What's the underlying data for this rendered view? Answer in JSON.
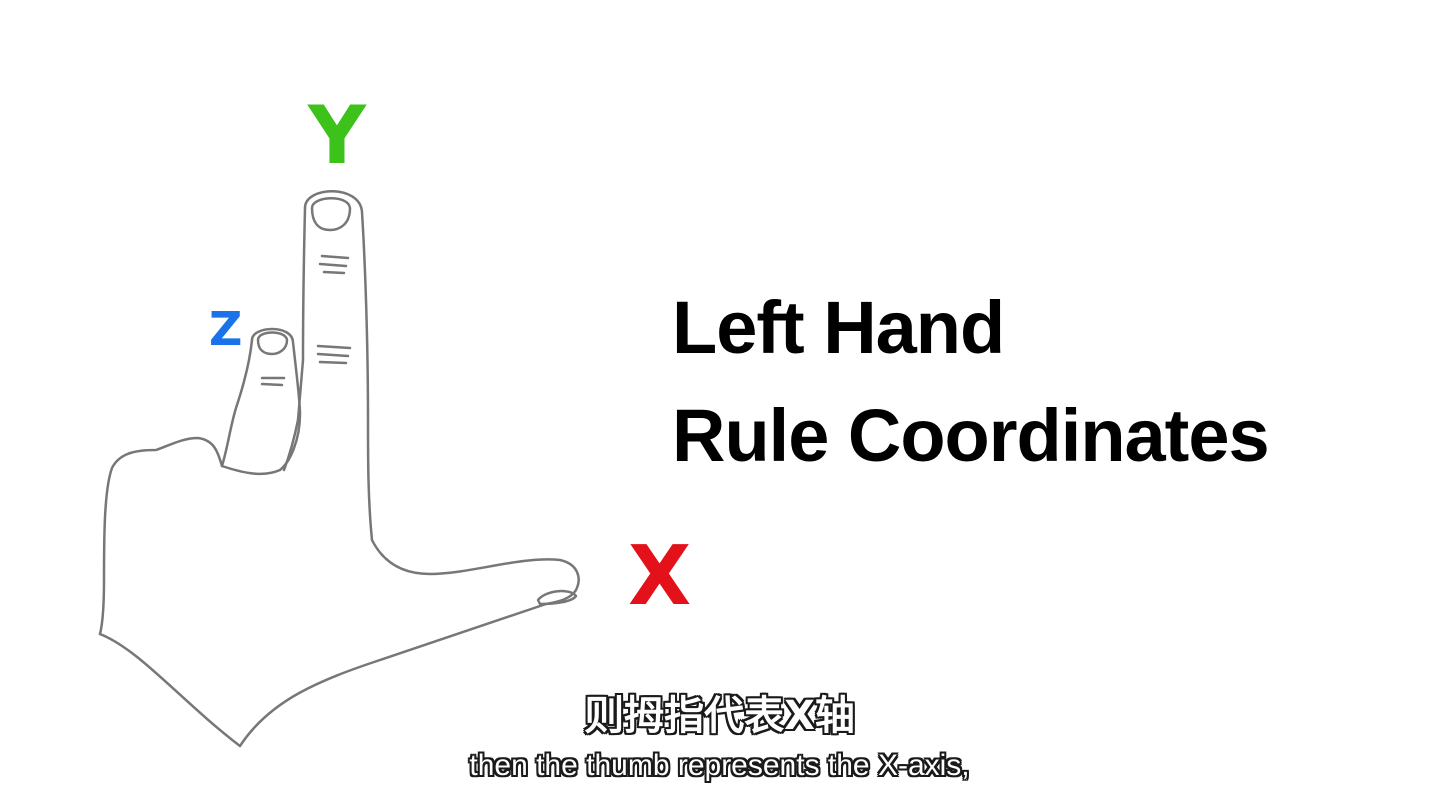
{
  "diagram": {
    "axes": {
      "y": {
        "label": "Y",
        "color": "#3cc21a"
      },
      "z": {
        "label": "Z",
        "color": "#1a73e8"
      },
      "x": {
        "label": "X",
        "color": "#e3111a"
      }
    },
    "illustration": "left-hand-icon",
    "outline_color": "#777777"
  },
  "title": {
    "line1": "Left Hand",
    "line2": "Rule Coordinates"
  },
  "subtitles": {
    "chinese": "则拇指代表X轴",
    "english": "then the thumb represents the X-axis,"
  }
}
